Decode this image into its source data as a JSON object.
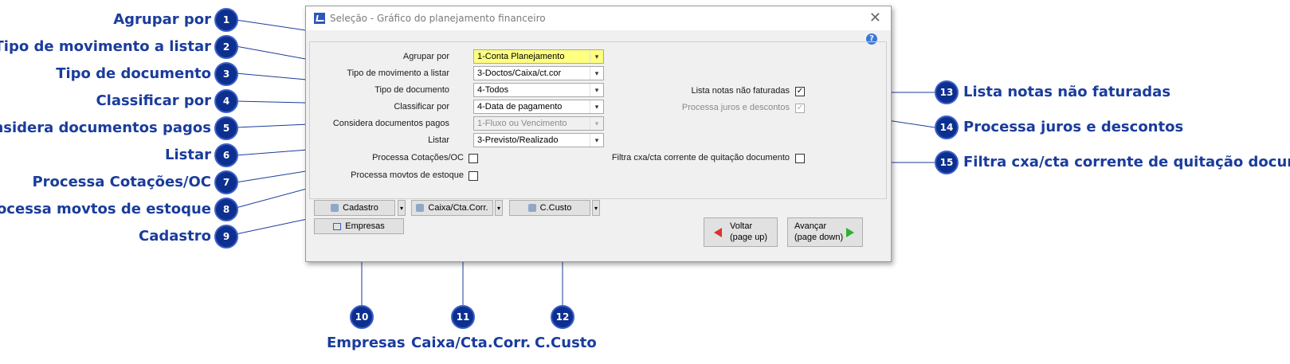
{
  "dialog": {
    "title": "Seleção - Gráfico do planejamento financeiro",
    "help_icon": "?",
    "close_icon": "✕"
  },
  "form": {
    "agrupar_label": "Agrupar por",
    "agrupar_value": "1-Conta Planejamento",
    "tipo_mov_label": "Tipo de movimento a listar",
    "tipo_mov_value": "3-Doctos/Caixa/ct.cor",
    "tipo_doc_label": "Tipo de documento",
    "tipo_doc_value": "4-Todos",
    "classificar_label": "Classificar por",
    "classificar_value": "4-Data de pagamento",
    "considera_label": "Considera documentos pagos",
    "considera_value": "1-Fluxo ou Vencimento",
    "listar_label": "Listar",
    "listar_value": "3-Previsto/Realizado",
    "cotacoes_label": "Processa Cotações/OC",
    "estoque_label": "Processa movtos de estoque",
    "notas_label": "Lista notas não faturadas",
    "juros_label": "Processa juros e descontos",
    "filtra_label": "Filtra cxa/cta corrente de quitação documento",
    "check_mark": "✓"
  },
  "buttons": {
    "cadastro": "Cadastro",
    "caixa": "Caixa/Cta.Corr.",
    "ccusto": "C.Custo",
    "empresas": "Empresas",
    "voltar_1": "Voltar",
    "voltar_2": "(page up)",
    "avancar_1": "Avançar",
    "avancar_2": "(page down)",
    "dropdown_arrow": "▾"
  },
  "callouts": {
    "c1": "Agrupar por",
    "c2": "Tipo de movimento a listar",
    "c3": "Tipo de documento",
    "c4": "Classificar por",
    "c5": "Considera documentos pagos",
    "c6": "Listar",
    "c7": "Processa Cotações/OC",
    "c8": "Processa movtos de estoque",
    "c9": "Cadastro",
    "c10": "Empresas",
    "c11": "Caixa/Cta.Corr.",
    "c12": "C.Custo",
    "c13": "Lista notas não faturadas",
    "c14": "Processa juros e descontos",
    "c15": "Filtra cxa/cta corrente de quitação documento"
  },
  "badges": [
    "1",
    "2",
    "3",
    "4",
    "5",
    "6",
    "7",
    "8",
    "9",
    "10",
    "11",
    "12",
    "13",
    "14",
    "15"
  ],
  "colors": {
    "callout_text": "#1a3c9c",
    "badge_fill": "#0d2f8f",
    "highlight_field": "#ffff80"
  }
}
